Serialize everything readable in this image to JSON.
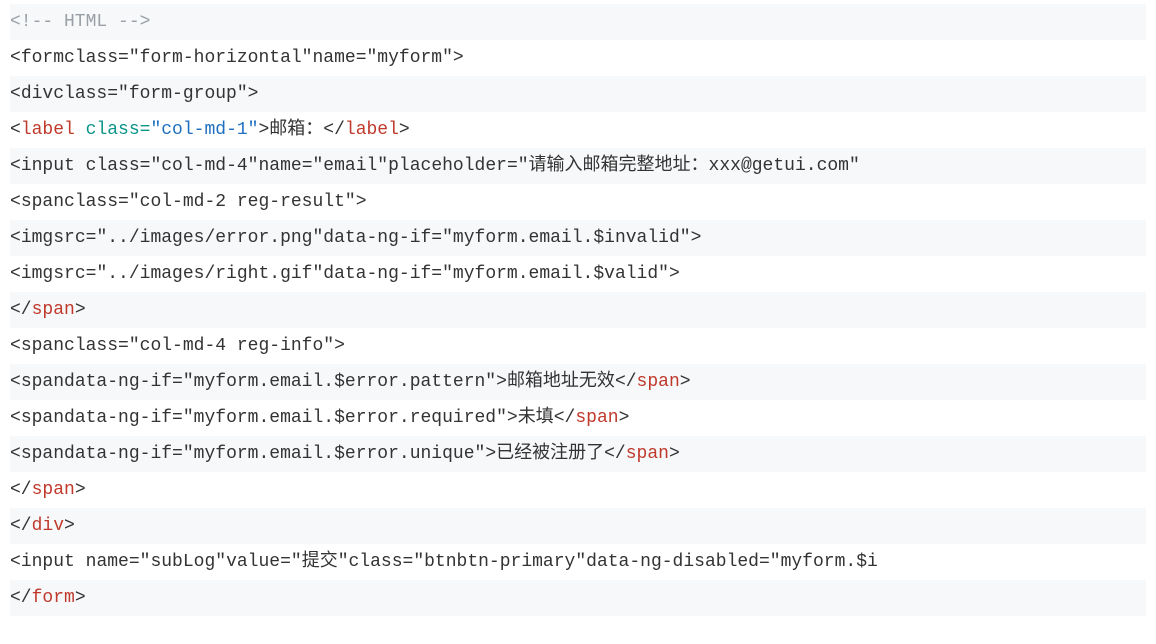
{
  "lines": {
    "l1": {
      "comment": "<!-- HTML -->"
    },
    "l2": {
      "open": "<",
      "tag": "form",
      "a1n": "class=",
      "a1v": "\"form-horizontal\"",
      "a2n": "name=",
      "a2v": "\"myform\"",
      "close": ">"
    },
    "l3": {
      "open": "<",
      "tag": "div",
      "a1n": "class=",
      "a1v": "\"form-group\"",
      "close": ">"
    },
    "l4": {
      "open": "<",
      "tag": "label",
      "sp": " ",
      "a1n": "class=",
      "a1v": "\"col-md-1\"",
      "midclose": ">",
      "text": "邮箱：",
      "copen": "</",
      "ctag": "label",
      "cclose": ">"
    },
    "l5": {
      "open": "<",
      "tag": "input",
      "sp": " ",
      "a1n": "class=",
      "a1v": "\"col-md-4\"",
      "a2n": "name=",
      "a2v": "\"email\"",
      "a3n": "placeholder=",
      "a3v": "\"请输入邮箱完整地址：xxx@getui.com\""
    },
    "l6": {
      "open": "<",
      "tag": "span",
      "a1n": "class=",
      "a1v": "\"col-md-2 reg-result\"",
      "close": ">"
    },
    "l7": {
      "open": "<",
      "tag": "img",
      "a1n": "src=",
      "a1v": "\"../images/error.png\"",
      "a2n": "data-ng-if=",
      "a2v": "\"myform.email.$invalid\"",
      "close": ">"
    },
    "l8": {
      "open": "<",
      "tag": "img",
      "a1n": "src=",
      "a1v": "\"../images/right.gif\"",
      "a2n": "data-ng-if=",
      "a2v": "\"myform.email.$valid\"",
      "close": ">"
    },
    "l9": {
      "copen": "</",
      "ctag": "span",
      "cclose": ">"
    },
    "l10": {
      "open": "<",
      "tag": "span",
      "a1n": "class=",
      "a1v": "\"col-md-4 reg-info\"",
      "close": ">"
    },
    "l11": {
      "open": "<",
      "tag": "span",
      "a1n": "data-ng-if=",
      "a1v": "\"myform.email.$error.pattern\"",
      "midclose": ">",
      "text": "邮箱地址无效",
      "copen": "</",
      "ctag": "span",
      "cclose": ">"
    },
    "l12": {
      "open": "<",
      "tag": "span",
      "a1n": "data-ng-if=",
      "a1v": "\"myform.email.$error.required\"",
      "midclose": ">",
      "text": "未填",
      "copen": "</",
      "ctag": "span",
      "cclose": ">"
    },
    "l13": {
      "open": "<",
      "tag": "span",
      "a1n": "data-ng-if=",
      "a1v": "\"myform.email.$error.unique\"",
      "midclose": ">",
      "text": "已经被注册了",
      "copen": "</",
      "ctag": "span",
      "cclose": ">"
    },
    "l14": {
      "copen": "</",
      "ctag": "span",
      "cclose": ">"
    },
    "l15": {
      "copen": "</",
      "ctag": "div",
      "cclose": ">"
    },
    "l16": {
      "open": "<",
      "tag": "input",
      "sp": " ",
      "a1n": "name=",
      "a1v": "\"subLog\"",
      "a2n": "value=",
      "a2v": "\"提交\"",
      "a3n": "class=",
      "a3v": "\"btnbtn-primary\"",
      "a4n": "data-ng-disabled=",
      "a4v": "\"myform.$i"
    },
    "l17": {
      "copen": "</",
      "ctag": "form",
      "cclose": ">"
    }
  }
}
